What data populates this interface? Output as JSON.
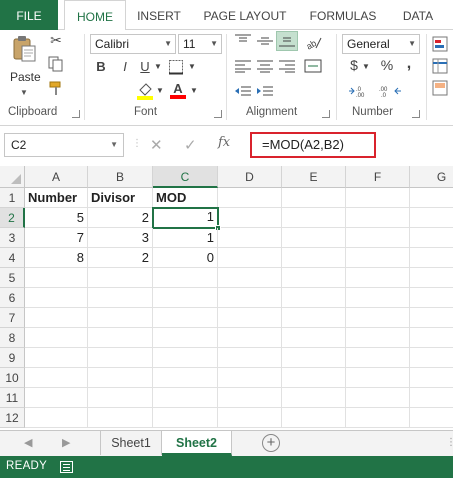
{
  "ribbon_tabs": [
    "FILE",
    "HOME",
    "INSERT",
    "PAGE LAYOUT",
    "FORMULAS",
    "DATA"
  ],
  "active_tab": "HOME",
  "clipboard": {
    "paste_label": "Paste",
    "group_label": "Clipboard"
  },
  "font": {
    "name": "Calibri",
    "size": "11",
    "group_label": "Font",
    "bold": "B",
    "italic": "I",
    "underline": "U"
  },
  "alignment": {
    "group_label": "Alignment"
  },
  "number": {
    "format": "General",
    "group_label": "Number",
    "currency": "$",
    "percent": "%",
    "comma": ","
  },
  "formula_bar": {
    "name_box": "C2",
    "fx": "fx",
    "formula": "=MOD(A2,B2)"
  },
  "columns": [
    "A",
    "B",
    "C",
    "D",
    "E",
    "F",
    "G"
  ],
  "selected_column": "C",
  "rows": [
    "1",
    "2",
    "3",
    "4",
    "5",
    "6",
    "7",
    "8",
    "9",
    "10",
    "11",
    "12"
  ],
  "selected_row": "2",
  "cells": {
    "A1": "Number",
    "B1": "Divisor",
    "C1": "MOD",
    "A2": "5",
    "B2": "2",
    "C2": "1",
    "A3": "7",
    "B3": "3",
    "C3": "1",
    "A4": "8",
    "B4": "2",
    "C4": "0"
  },
  "sheets": [
    "Sheet1",
    "Sheet2"
  ],
  "active_sheet": "Sheet2",
  "status": {
    "text": "READY"
  },
  "colors": {
    "accent": "#217346",
    "highlight": "#d9232d"
  }
}
